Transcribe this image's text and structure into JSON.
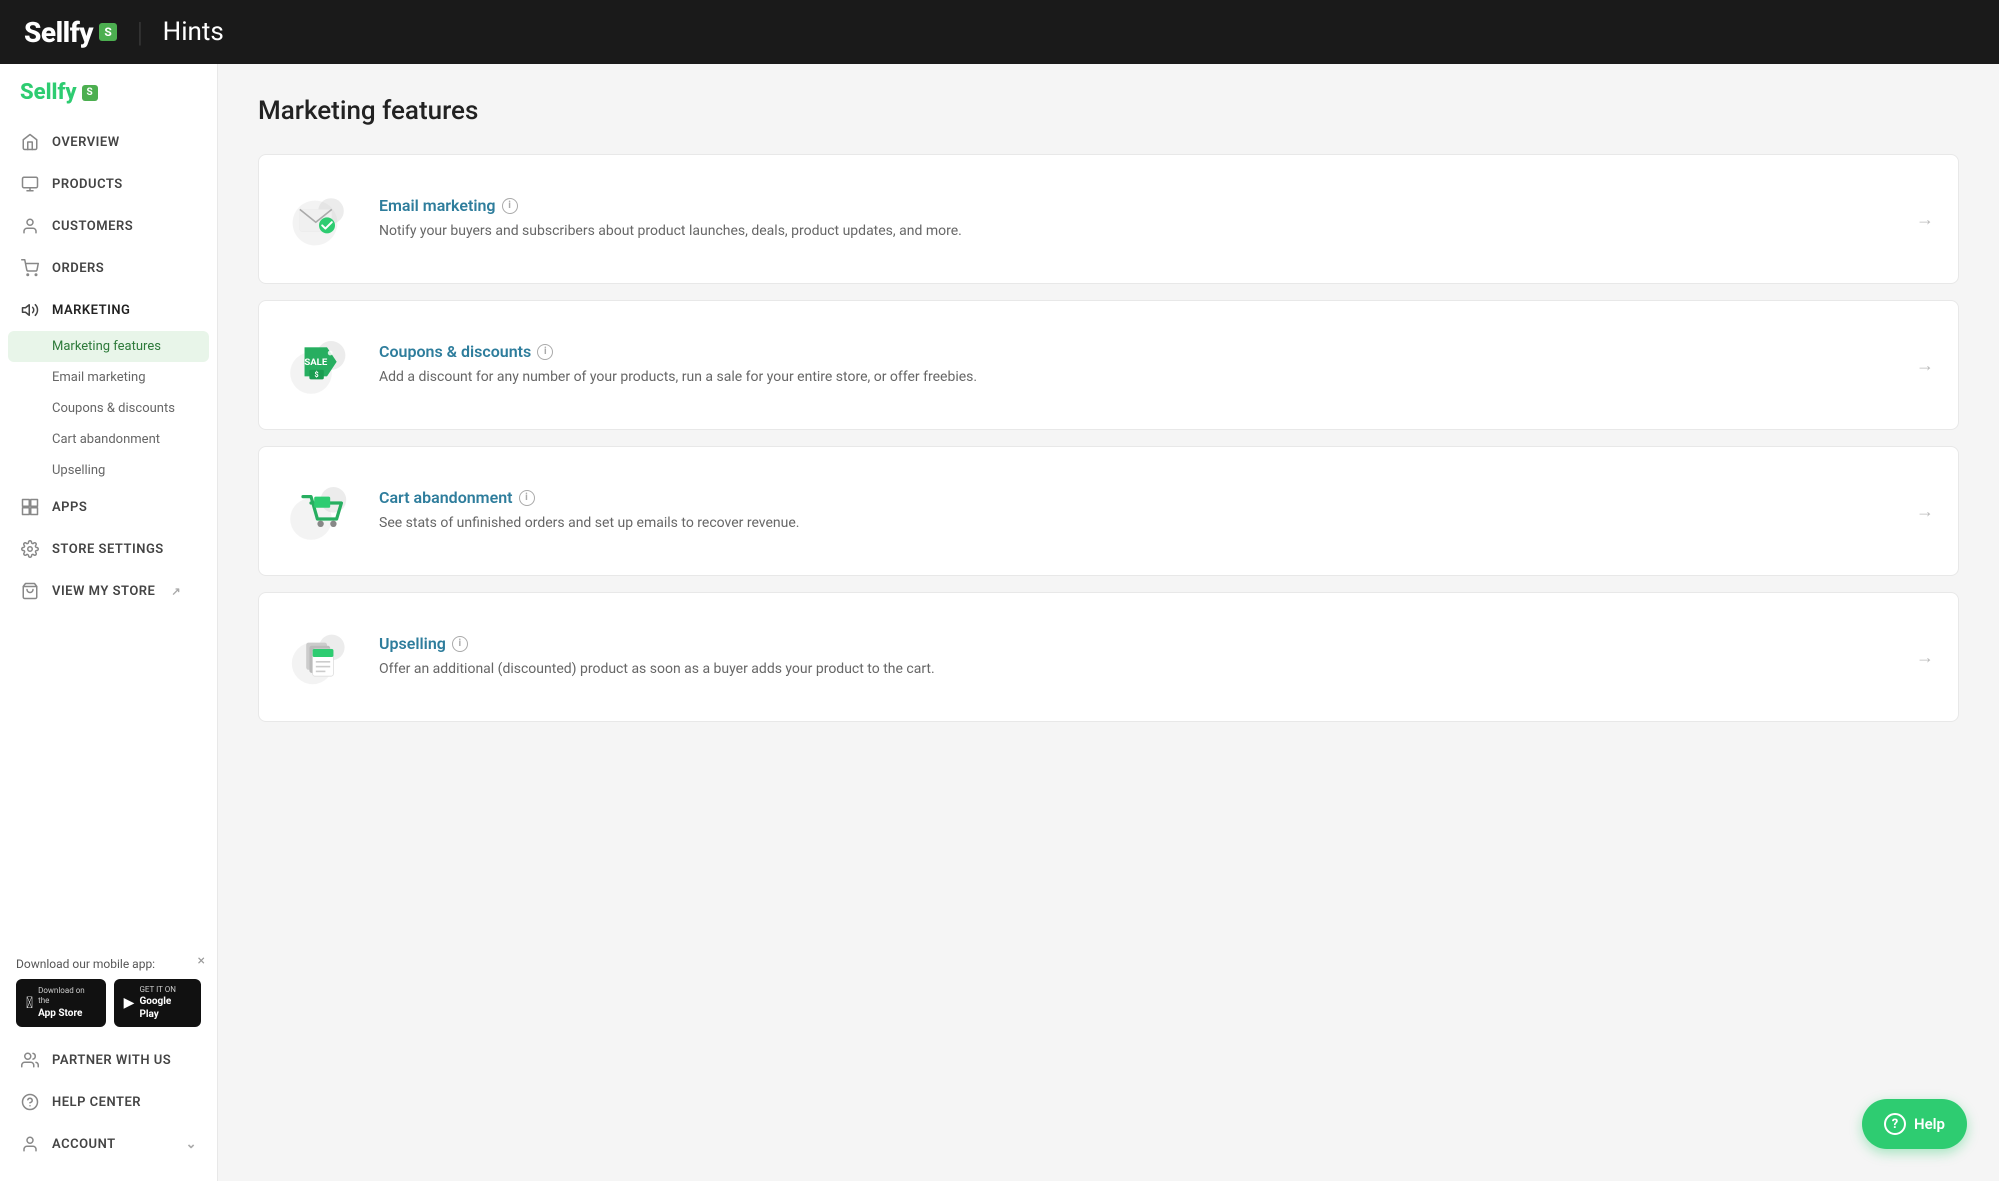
{
  "header": {
    "logo_text": "Sellfy",
    "logo_badge": "S",
    "divider": "|",
    "title": "Hints"
  },
  "sidebar": {
    "brand_text": "Sellfy",
    "brand_badge": "S",
    "nav_items": [
      {
        "id": "overview",
        "label": "Overview",
        "icon": "home-icon"
      },
      {
        "id": "products",
        "label": "Products",
        "icon": "products-icon"
      },
      {
        "id": "customers",
        "label": "Customers",
        "icon": "customers-icon"
      },
      {
        "id": "orders",
        "label": "Orders",
        "icon": "orders-icon"
      },
      {
        "id": "marketing",
        "label": "Marketing",
        "icon": "marketing-icon"
      }
    ],
    "marketing_sub": [
      {
        "id": "marketing-features",
        "label": "Marketing features",
        "active": true
      },
      {
        "id": "email-marketing",
        "label": "Email marketing"
      },
      {
        "id": "coupons-discounts",
        "label": "Coupons & discounts"
      },
      {
        "id": "cart-abandonment",
        "label": "Cart abandonment"
      },
      {
        "id": "upselling",
        "label": "Upselling"
      }
    ],
    "nav_items_bottom": [
      {
        "id": "apps",
        "label": "Apps",
        "icon": "apps-icon"
      },
      {
        "id": "store-settings",
        "label": "Store Settings",
        "icon": "settings-icon"
      },
      {
        "id": "view-my-store",
        "label": "View My Store",
        "icon": "store-icon",
        "external": true
      }
    ],
    "mobile_app": {
      "label": "Download our mobile app:",
      "apple_store_line1": "Download on the",
      "apple_store_line2": "App Store",
      "google_play_line1": "GET IT ON",
      "google_play_line2": "Google Play"
    },
    "partner": {
      "label": "Partner With Us",
      "icon": "partner-icon"
    },
    "help_center": {
      "label": "Help Center",
      "icon": "help-center-icon"
    },
    "account": {
      "label": "Account",
      "icon": "account-icon"
    }
  },
  "main": {
    "page_title": "Marketing features",
    "cards": [
      {
        "id": "email-marketing",
        "title": "Email marketing",
        "description": "Notify your buyers and subscribers about product launches, deals, product updates, and more.",
        "icon": "email-marketing-icon"
      },
      {
        "id": "coupons-discounts",
        "title": "Coupons & discounts",
        "description": "Add a discount for any number of your products, run a sale for your entire store, or offer freebies.",
        "icon": "coupons-discounts-icon"
      },
      {
        "id": "cart-abandonment",
        "title": "Cart abandonment",
        "description": "See stats of unfinished orders and set up emails to recover revenue.",
        "icon": "cart-abandonment-icon"
      },
      {
        "id": "upselling",
        "title": "Upselling",
        "description": "Offer an additional (discounted) product as soon as a buyer adds your product to the cart.",
        "icon": "upselling-icon"
      }
    ]
  },
  "help_button": {
    "label": "Help",
    "question_mark": "?"
  },
  "colors": {
    "accent_green": "#2ecc71",
    "link_blue": "#2e7d9c",
    "sidebar_bg": "#ffffff",
    "header_bg": "#1a1a1a"
  }
}
